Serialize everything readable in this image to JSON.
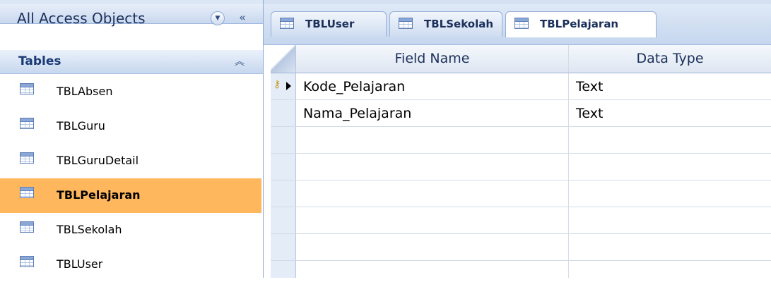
{
  "nav": {
    "title": "All Access Objects",
    "dropdown_icon": "chevron-down-icon",
    "collapse_label": "«",
    "group": {
      "title": "Tables",
      "toggle_label": "⌃⌃"
    },
    "items": [
      {
        "label": "TBLAbsen",
        "selected": false
      },
      {
        "label": "TBLGuru",
        "selected": false
      },
      {
        "label": "TBLGuruDetail",
        "selected": false
      },
      {
        "label": "TBLPelajaran",
        "selected": true
      },
      {
        "label": "TBLSekolah",
        "selected": false
      },
      {
        "label": "TBLUser",
        "selected": false
      }
    ],
    "selected_color": "#ffb75e"
  },
  "tabs": [
    {
      "label": "TBLUser",
      "active": false
    },
    {
      "label": "TBLSekolah",
      "active": false
    },
    {
      "label": "TBLPelajaran",
      "active": true
    }
  ],
  "grid": {
    "columns": [
      "Field Name",
      "Data Type"
    ],
    "rows": [
      {
        "field": "Kode_Pelajaran",
        "type": "Text",
        "primary_key": true,
        "current": true
      },
      {
        "field": "Nama_Pelajaran",
        "type": "Text",
        "primary_key": false,
        "current": false
      }
    ]
  }
}
